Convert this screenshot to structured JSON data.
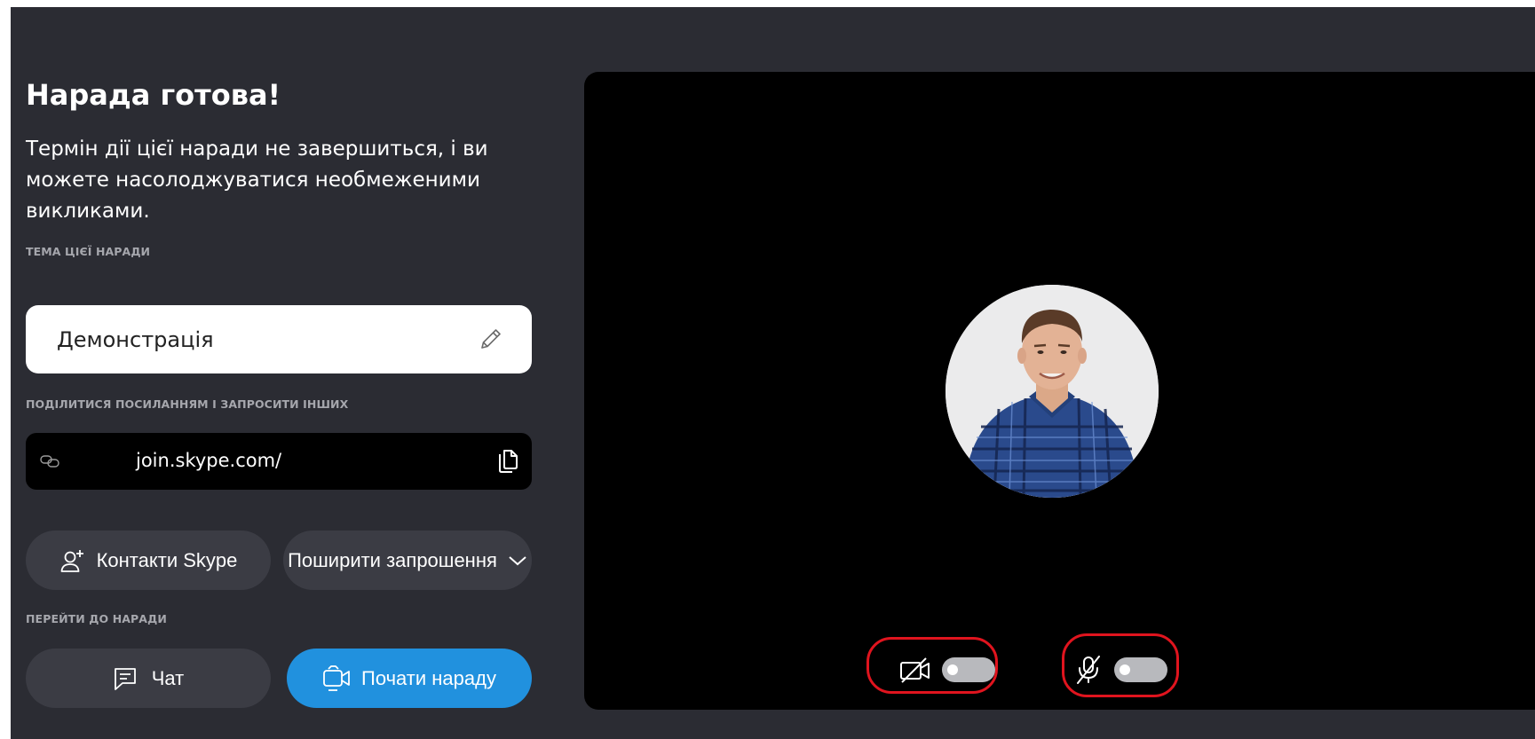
{
  "meeting": {
    "title": "Нарада готова!",
    "description": "Термін дії цієї наради не завершиться, і ви можете насолоджуватися необмеженими викликами."
  },
  "topic": {
    "label": "ТЕМА ЦІЄЇ НАРАДИ",
    "value": "Демонстрація",
    "edit_icon": "pencil-icon"
  },
  "share": {
    "label": "ПОДІЛИТИСЯ ПОСИЛАННЯМ І ЗАПРОСИТИ ІНШИХ",
    "link": "join.skype.com/",
    "link_icon": "link-icon",
    "copy_icon": "copy-icon",
    "contacts_button": "Контакти Skype",
    "contacts_icon": "add-contact-icon",
    "invite_button": "Поширити запрошення",
    "invite_icon": "chevron-down-icon"
  },
  "join": {
    "label": "ПЕРЕЙТИ ДО НАРАДИ",
    "chat_button": "Чат",
    "chat_icon": "chat-icon",
    "start_button": "Почати нараду",
    "start_icon": "video-camera-icon"
  },
  "preview": {
    "avatar": "user-avatar",
    "camera_toggle": {
      "icon": "camera-off-icon",
      "on": false
    },
    "mic_toggle": {
      "icon": "mic-off-icon",
      "on": false
    }
  },
  "colors": {
    "background": "#2b2c33",
    "pill_button": "#3b3c44",
    "accent": "#2191de",
    "video_bg": "#000000",
    "annotation": "#e0141e"
  }
}
